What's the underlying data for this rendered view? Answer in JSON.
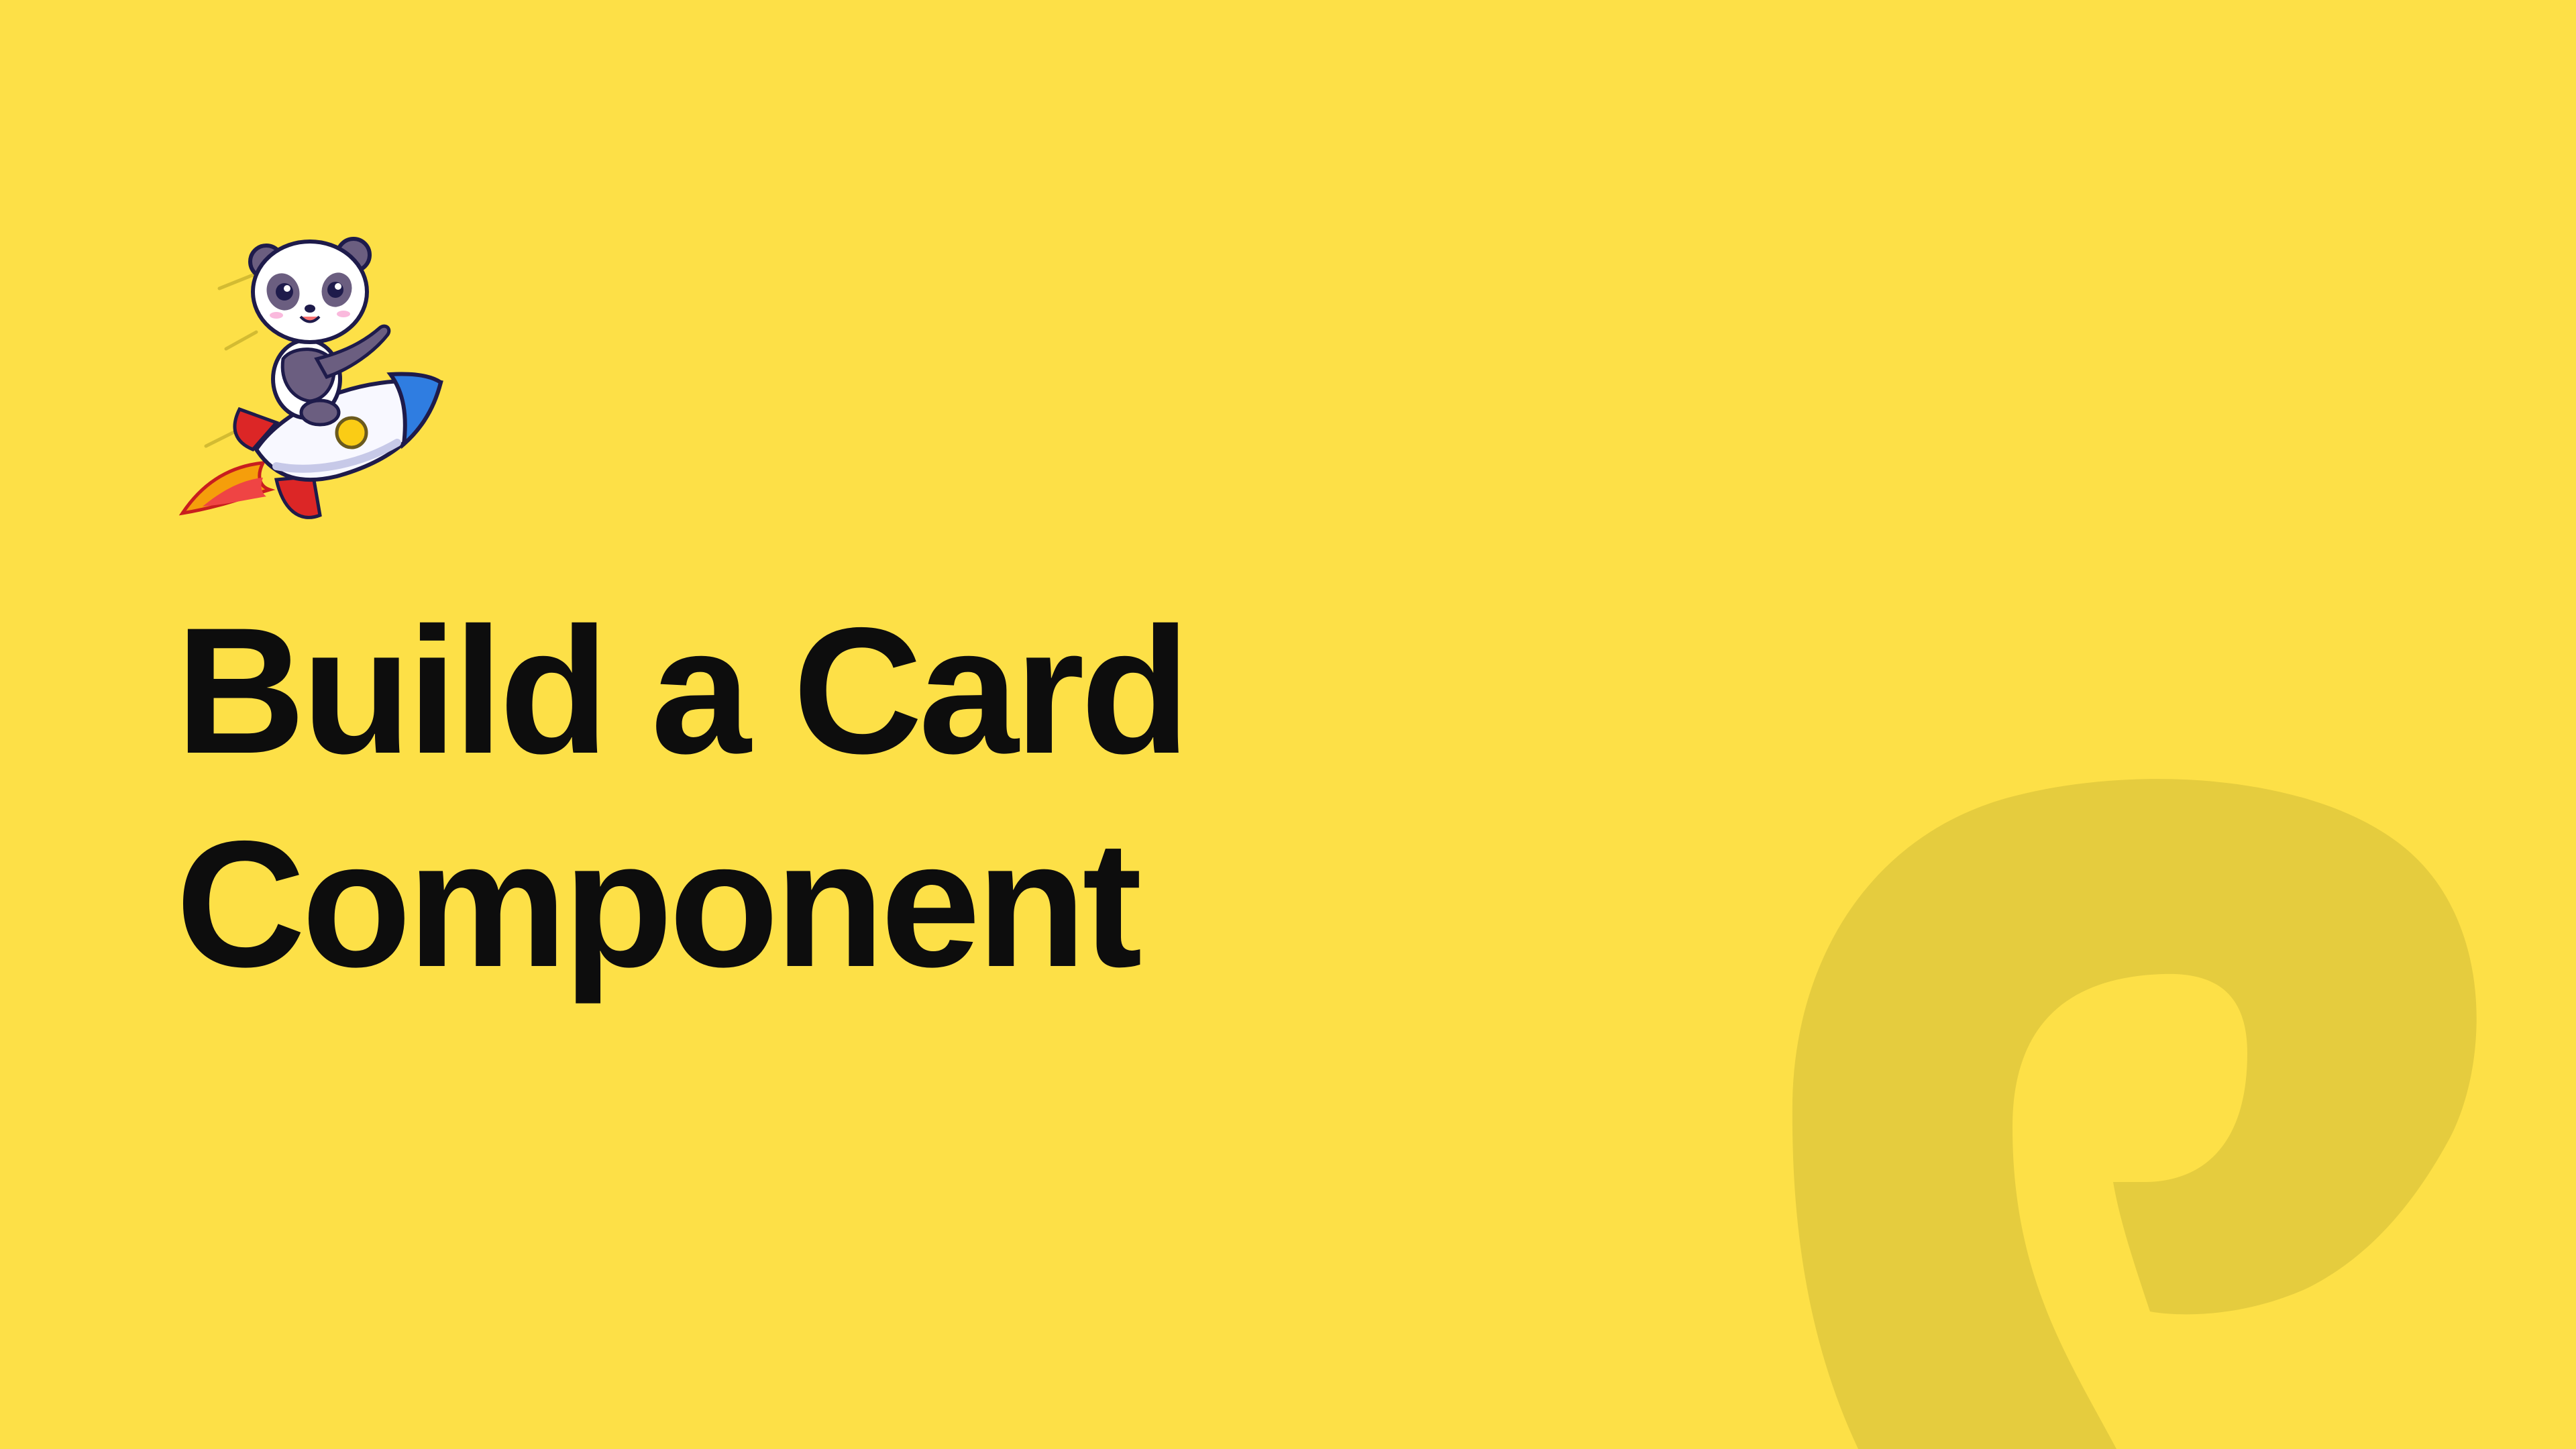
{
  "slide": {
    "background_color": "#FDE047",
    "title_lines": [
      "Build a Card",
      "Component"
    ]
  },
  "mascot": {
    "icon": "panda-riding-rocket-icon"
  },
  "watermark": {
    "icon": "brand-logo-watermark-icon",
    "color": "#E5CC3E"
  }
}
